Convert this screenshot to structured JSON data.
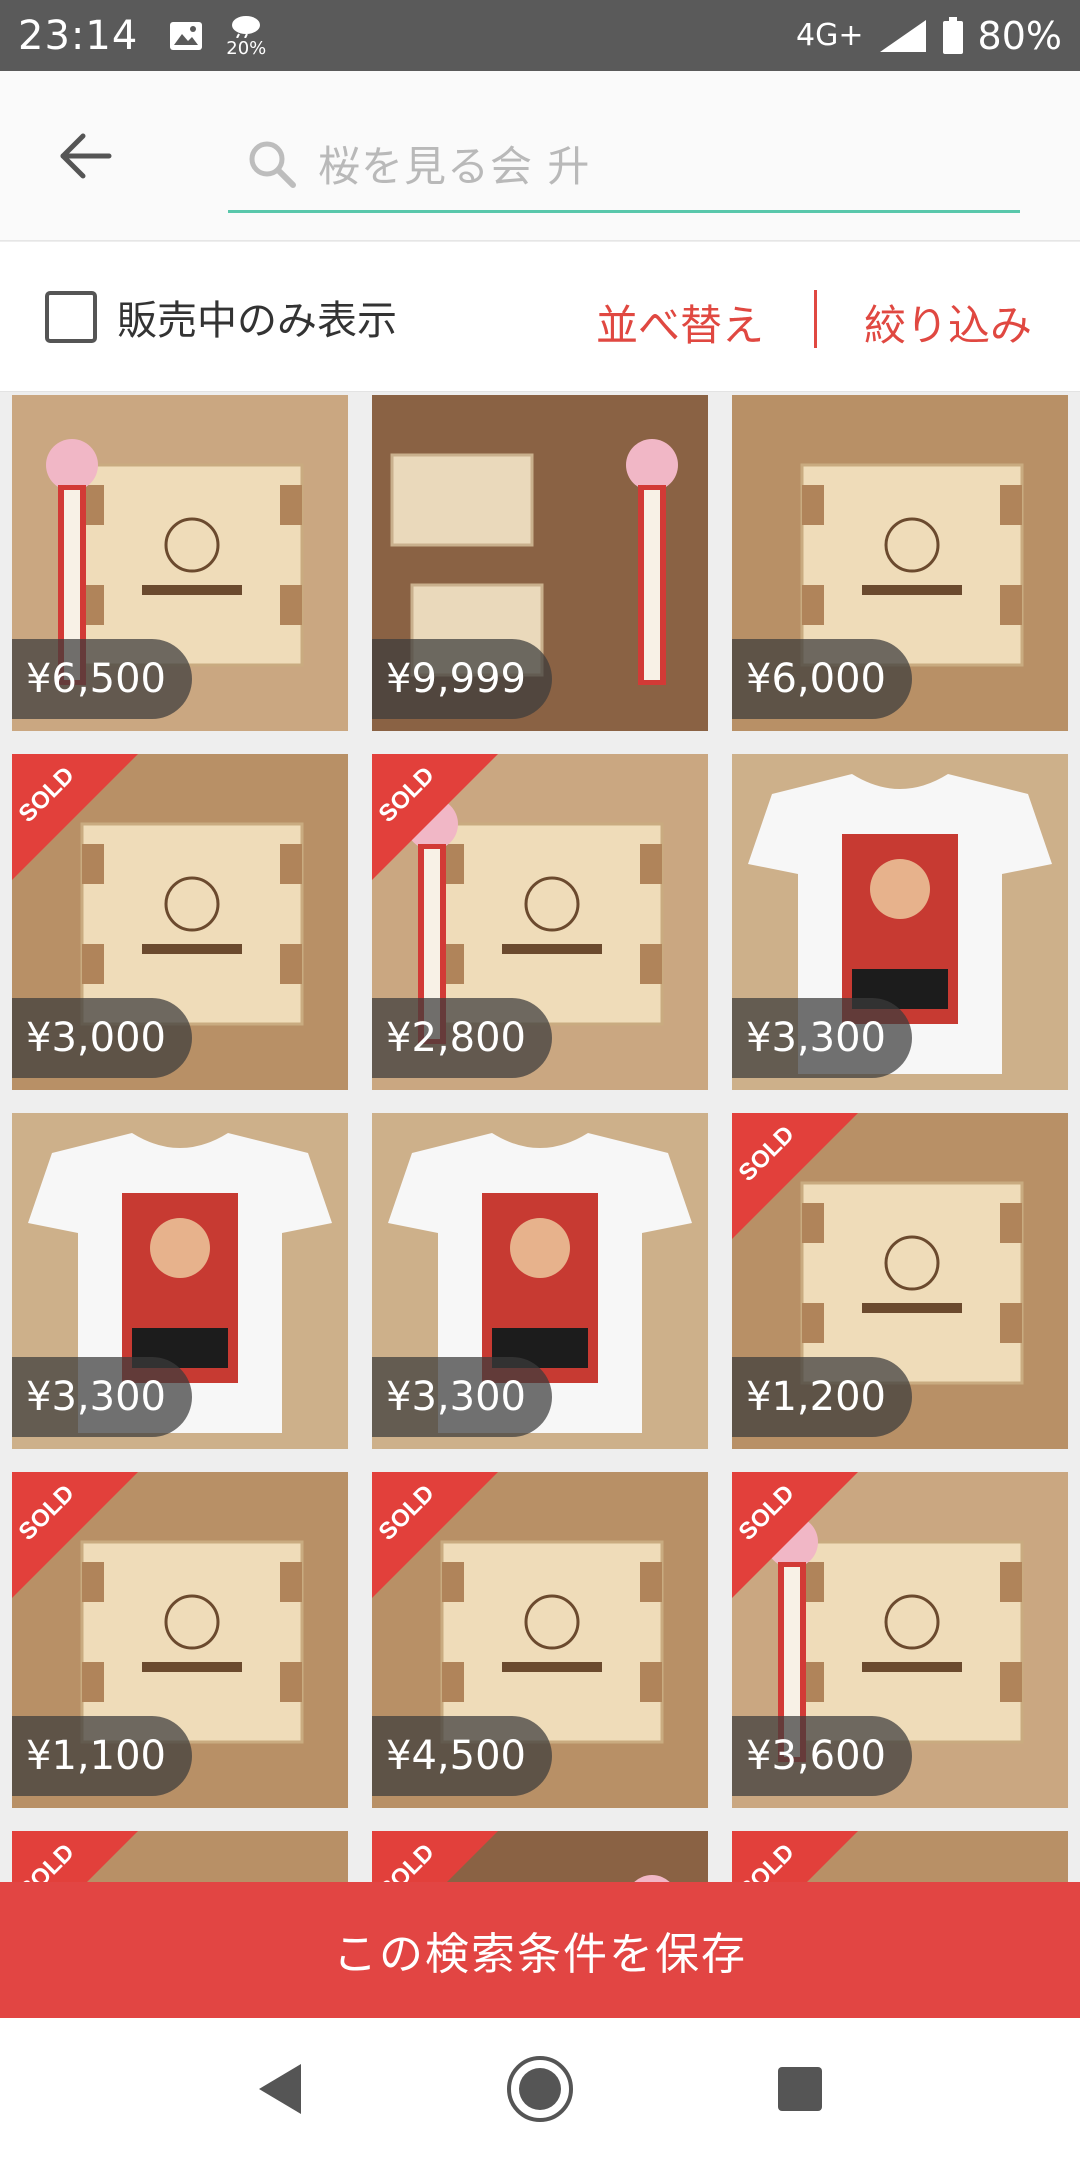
{
  "status_bar": {
    "time": "23:14",
    "weather": "20%",
    "network": "4G+",
    "battery": "80%"
  },
  "search": {
    "query": "桜を見る会 升"
  },
  "filter": {
    "on_sale_only_label": "販売中のみ表示",
    "sort_label": "並べ替え",
    "refine_label": "絞り込み"
  },
  "items": [
    {
      "price": "¥6,500",
      "sold": false,
      "kind": "masu-ribbon"
    },
    {
      "price": "¥9,999",
      "sold": false,
      "kind": "masu-flat"
    },
    {
      "price": "¥6,000",
      "sold": false,
      "kind": "masu"
    },
    {
      "price": "¥3,000",
      "sold": true,
      "kind": "masu"
    },
    {
      "price": "¥2,800",
      "sold": true,
      "kind": "masu-ribbon"
    },
    {
      "price": "¥3,300",
      "sold": false,
      "kind": "tshirt"
    },
    {
      "price": "¥3,300",
      "sold": false,
      "kind": "tshirt"
    },
    {
      "price": "¥3,300",
      "sold": false,
      "kind": "tshirt"
    },
    {
      "price": "¥1,200",
      "sold": true,
      "kind": "masu"
    },
    {
      "price": "¥1,100",
      "sold": true,
      "kind": "masu"
    },
    {
      "price": "¥4,500",
      "sold": true,
      "kind": "masu"
    },
    {
      "price": "¥3,600",
      "sold": true,
      "kind": "masu-ribbon"
    },
    {
      "price": "",
      "sold": true,
      "kind": "masu"
    },
    {
      "price": "",
      "sold": true,
      "kind": "masu-flat"
    },
    {
      "price": "",
      "sold": true,
      "kind": "masu"
    }
  ],
  "sold_text": "SOLD",
  "save_search_label": "この検索条件を保存"
}
